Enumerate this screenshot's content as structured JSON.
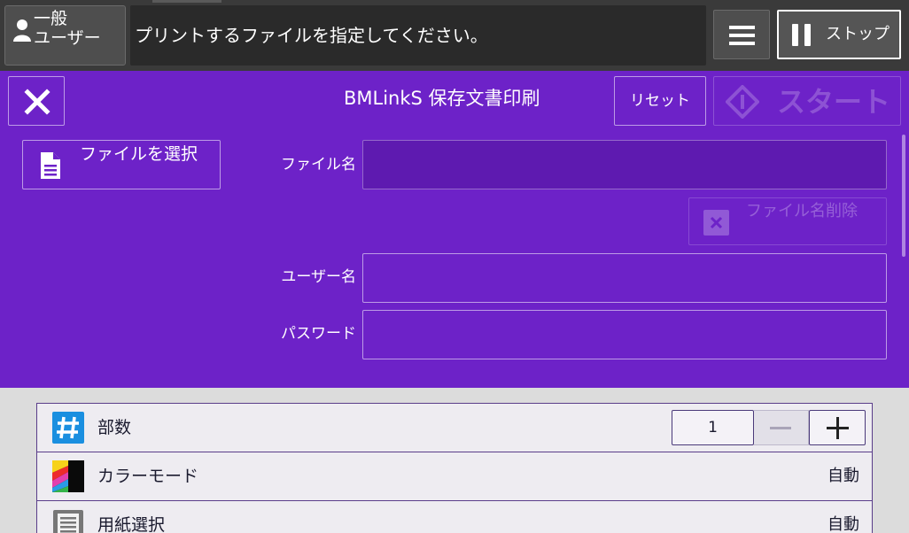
{
  "topbar": {
    "user_line1": "一般",
    "user_line2": "ユーザー",
    "message": "プリントするファイルを指定してください。",
    "stop_label": "ストップ"
  },
  "panel": {
    "title": "BMLinkS 保存文書印刷",
    "reset_label": "リセット",
    "start_label": "スタート",
    "select_file_label": "ファイルを選択",
    "filename_label": "ファイル名",
    "filename_value": "",
    "delete_filename_label": "ファイル名削除",
    "username_label": "ユーザー名",
    "username_value": "",
    "password_label": "パスワード",
    "password_value": ""
  },
  "settings": {
    "copies": {
      "label": "部数",
      "value": "1"
    },
    "color_mode": {
      "label": "カラーモード",
      "value": "自動"
    },
    "paper_select": {
      "label": "用紙選択",
      "value": "自動"
    }
  },
  "colors": {
    "panel": "#6d22c8",
    "topbar": "#3a3a3a",
    "settings_bg": "#dcdcdc",
    "accent_blue": "#1a8fe0"
  },
  "icons": [
    "person-icon",
    "menu-icon",
    "pause-icon",
    "close-icon",
    "start-diamond-icon",
    "document-icon",
    "delete-box-icon",
    "hash-icon",
    "color-mode-icon",
    "paper-icon",
    "minus-icon",
    "plus-icon"
  ]
}
